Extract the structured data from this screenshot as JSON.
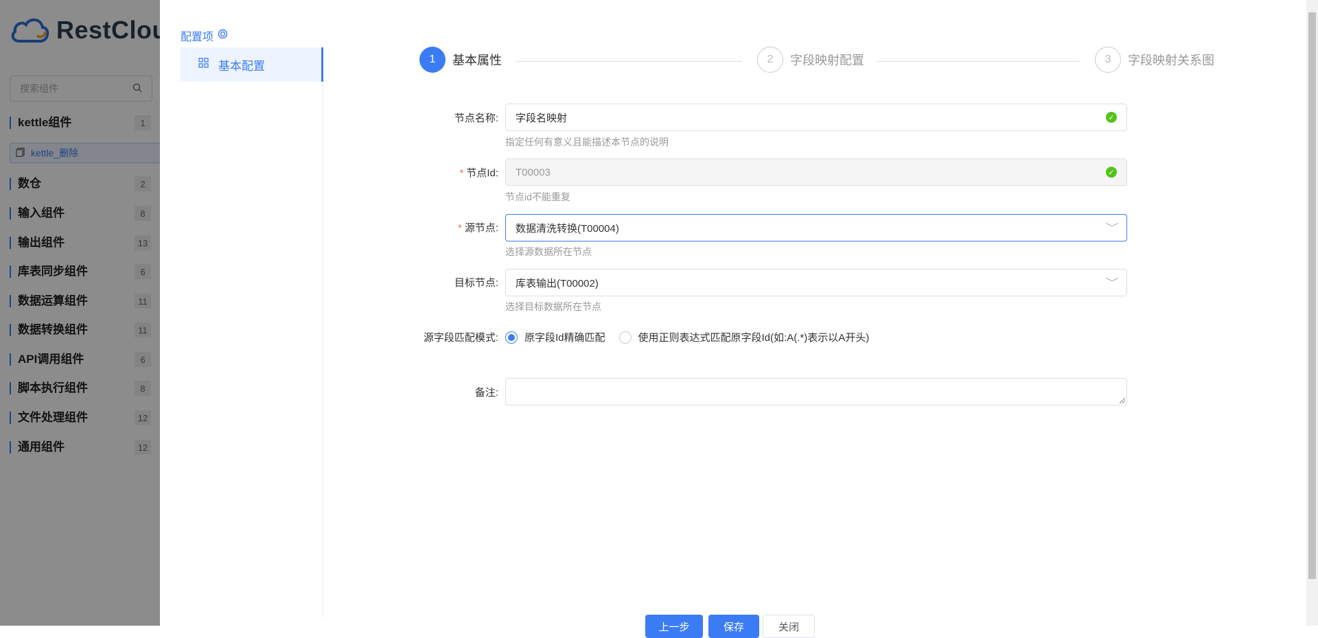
{
  "background": {
    "logo_text": "RestClou",
    "search_placeholder": "搜索组件",
    "categories": [
      {
        "label": "kettle组件",
        "count": "1"
      },
      {
        "label": "数仓",
        "count": "2"
      },
      {
        "label": "输入组件",
        "count": "8"
      },
      {
        "label": "输出组件",
        "count": "13"
      },
      {
        "label": "库表同步组件",
        "count": "6"
      },
      {
        "label": "数据运算组件",
        "count": "11"
      },
      {
        "label": "数据转换组件",
        "count": "11"
      },
      {
        "label": "API调用组件",
        "count": "6"
      },
      {
        "label": "脚本执行组件",
        "count": "8"
      },
      {
        "label": "文件处理组件",
        "count": "12"
      },
      {
        "label": "通用组件",
        "count": "12"
      }
    ],
    "sub_item": "kettle_删除"
  },
  "drawer": {
    "config_title": "配置项",
    "menu_item": "基本配置",
    "steps": [
      {
        "num": "1",
        "label": "基本属性"
      },
      {
        "num": "2",
        "label": "字段映射配置"
      },
      {
        "num": "3",
        "label": "字段映射关系图"
      }
    ],
    "form": {
      "node_name_label": "节点名称:",
      "node_name_value": "字段名映射",
      "node_name_hint": "指定任何有意义且能描述本节点的说明",
      "node_id_label": "节点Id:",
      "node_id_value": "T00003",
      "node_id_hint": "节点id不能重复",
      "source_label": "源节点:",
      "source_value": "数据清洗转换(T00004)",
      "source_hint": "选择源数据所在节点",
      "target_label": "目标节点:",
      "target_value": "库表输出(T00002)",
      "target_hint": "选择目标数据所在节点",
      "match_label": "源字段匹配模式:",
      "match_options": [
        "原字段Id精确匹配",
        "使用正则表达式匹配原字段Id(如:A(.*)表示以A开头)"
      ],
      "match_selected": 0,
      "remark_label": "备注:"
    },
    "footer": {
      "btn1": "上一步",
      "btn2": "保存",
      "btn3": "关闭"
    }
  },
  "colors": {
    "accent": "#3b7cf5",
    "success": "#52c41a",
    "required": "#f56c6c"
  }
}
